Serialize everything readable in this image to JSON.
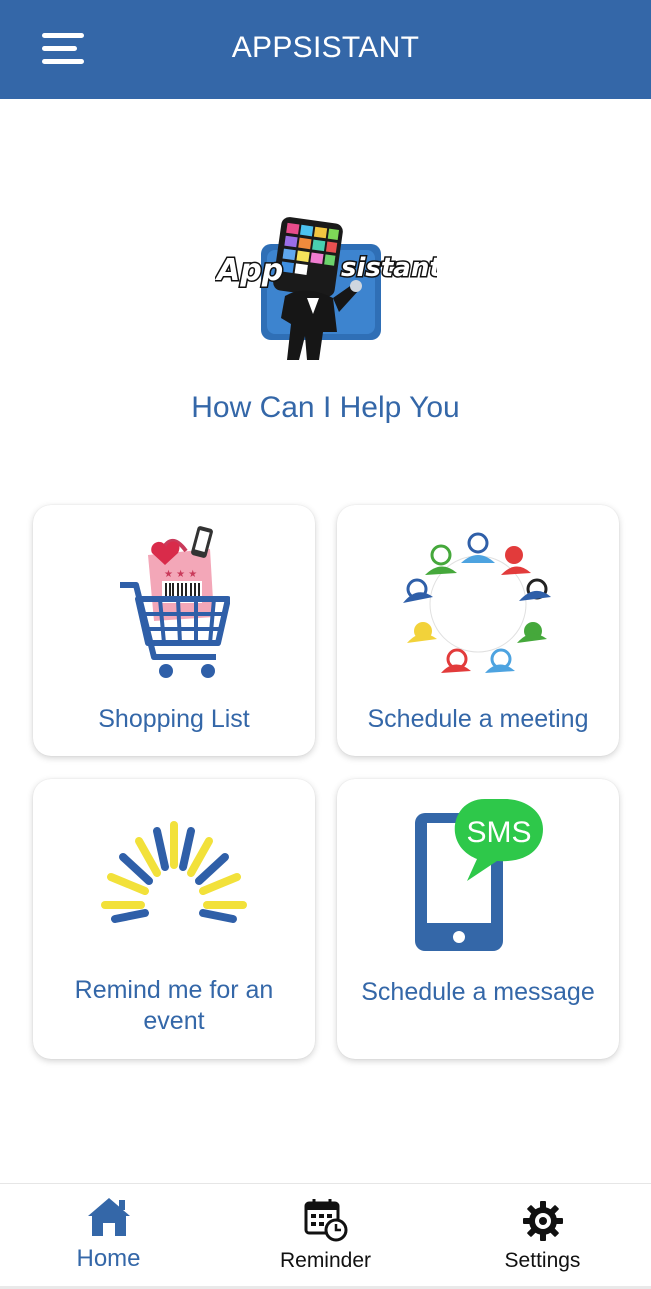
{
  "app_bar": {
    "title": "APPSISTANT"
  },
  "logo": {
    "text_left": "App",
    "text_right": "sistant"
  },
  "headline": "How Can I Help You",
  "cards": [
    {
      "label": "Shopping List",
      "icon": "shopping-cart-icon"
    },
    {
      "label": "Schedule a meeting",
      "icon": "meeting-people-icon"
    },
    {
      "label": "Remind me for an event",
      "line1": "Remind me for an",
      "line2": "event",
      "icon": "burst-icon"
    },
    {
      "label": "Schedule a message",
      "icon": "sms-phone-icon",
      "badge": "SMS"
    }
  ],
  "bottom_nav": [
    {
      "label": "Home",
      "icon": "home-icon",
      "active": true
    },
    {
      "label": "Reminder",
      "icon": "calendar-clock-icon",
      "active": false
    },
    {
      "label": "Settings",
      "icon": "gear-icon",
      "active": false
    }
  ],
  "colors": {
    "primary": "#3467a8",
    "accent_yellow": "#f2e13a",
    "sms_green": "#2ec84a"
  }
}
